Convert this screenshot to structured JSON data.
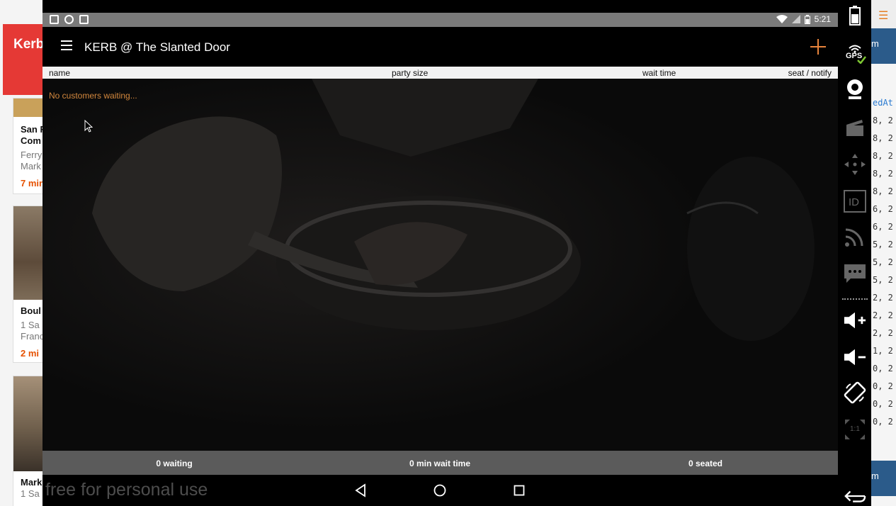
{
  "background_app": {
    "title": "Kerb",
    "cards": [
      {
        "name": "San F",
        "name2": "Com",
        "sub1": "Ferry",
        "sub2": "Mark",
        "time": "7 min"
      },
      {
        "name": "Boul",
        "sub1": "1 Sa",
        "sub2": "Franc",
        "time": "2 mi"
      },
      {
        "name": "Mark",
        "sub1": "1 Sa"
      }
    ]
  },
  "background_code": {
    "header_text": "m",
    "column_label": "edAt",
    "lines": [
      "8, 2",
      "8, 2",
      "8, 2",
      "8, 2",
      "8, 2",
      "6, 2",
      "6, 2",
      "5, 2",
      "5, 2",
      "5, 2",
      "2, 2",
      "2, 2",
      "2, 2",
      "1, 2",
      "0, 2",
      "0, 2",
      "0, 2",
      "0, 2"
    ],
    "footer_text": "m"
  },
  "status_bar": {
    "time": "5:21"
  },
  "app_bar": {
    "title": "KERB @ The Slanted Door",
    "add_icon": "plus-icon",
    "menu_icon": "hamburger-icon"
  },
  "table": {
    "columns": [
      "name",
      "party size",
      "wait time",
      "seat / notify"
    ],
    "empty_message": "No customers waiting..."
  },
  "summary": {
    "waiting": "0 waiting",
    "wait_time": "0 min wait time",
    "seated": "0 seated"
  },
  "nav_bar": {
    "watermark": "free for personal use",
    "buttons": [
      "back-icon",
      "home-icon",
      "recents-icon"
    ]
  },
  "emulator_toolbar": {
    "gps_label": "GPS",
    "scale_label": "1:1",
    "tools": [
      "battery-icon",
      "gps-icon",
      "camera-icon",
      "video-icon",
      "dpad-icon",
      "id-icon",
      "rss-icon",
      "sms-icon",
      "volume-up-icon",
      "volume-down-icon",
      "rotate-icon",
      "scale-icon",
      "back-icon"
    ]
  },
  "colors": {
    "accent": "#e8843c",
    "status_bar": "#7a7a7a",
    "summary_bar": "#5b5b5b",
    "header_bg": "#f2f2f2"
  }
}
